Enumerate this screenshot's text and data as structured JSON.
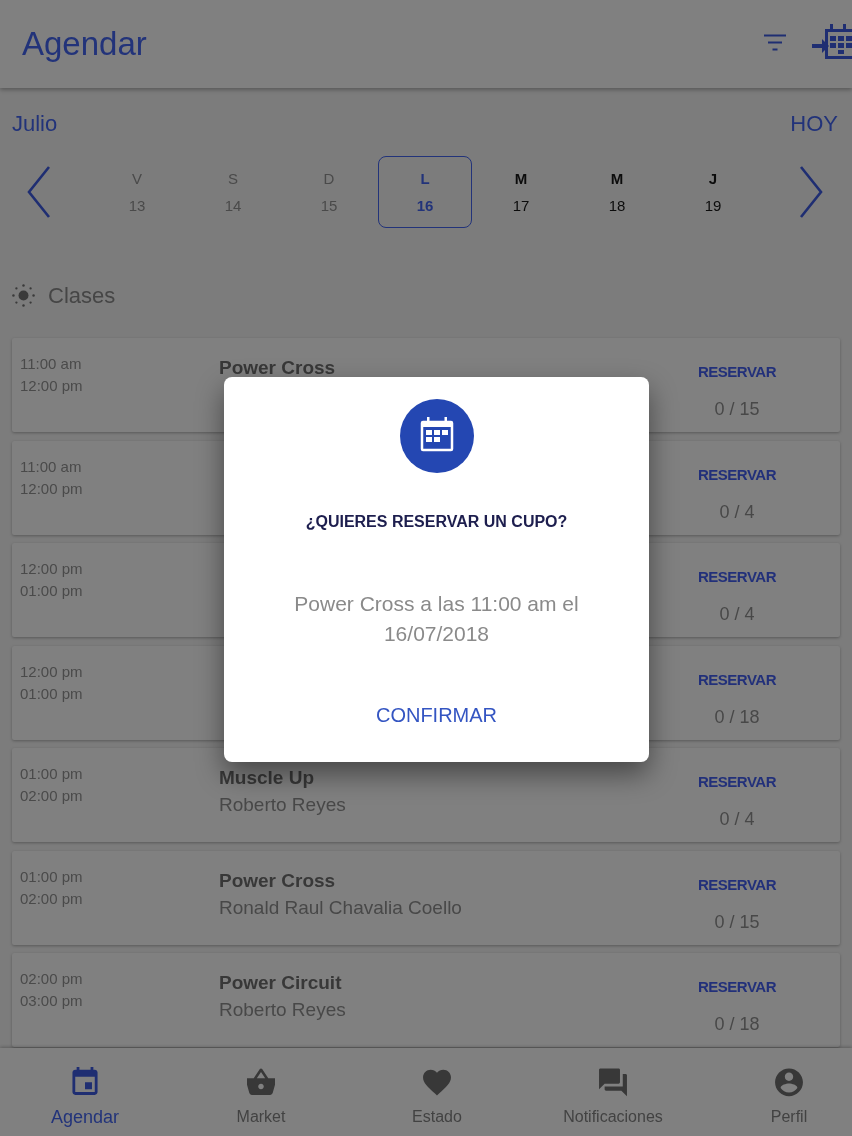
{
  "header": {
    "title": "Agendar"
  },
  "calendar": {
    "month": "Julio",
    "today_button": "HOY",
    "days": [
      {
        "weekday": "V",
        "date": "13",
        "disabled": true,
        "selected": false
      },
      {
        "weekday": "S",
        "date": "14",
        "disabled": true,
        "selected": false
      },
      {
        "weekday": "D",
        "date": "15",
        "disabled": true,
        "selected": false
      },
      {
        "weekday": "L",
        "date": "16",
        "disabled": false,
        "selected": true
      },
      {
        "weekday": "M",
        "date": "17",
        "disabled": false,
        "selected": false
      },
      {
        "weekday": "M",
        "date": "18",
        "disabled": false,
        "selected": false
      },
      {
        "weekday": "J",
        "date": "19",
        "disabled": false,
        "selected": false
      }
    ]
  },
  "section": {
    "title": "Clases"
  },
  "classes": [
    {
      "start": "11:00 am",
      "end": "12:00 pm",
      "name": "Power Cross",
      "action": "RESERVAR",
      "capacity": "0 / 15"
    },
    {
      "start": "11:00 am",
      "end": "12:00 pm",
      "action": "RESERVAR",
      "capacity": "0 / 4"
    },
    {
      "start": "12:00 pm",
      "end": "01:00 pm",
      "action": "RESERVAR",
      "capacity": "0 / 4"
    },
    {
      "start": "12:00 pm",
      "end": "01:00 pm",
      "action": "RESERVAR",
      "capacity": "0 / 18"
    },
    {
      "start": "01:00 pm",
      "end": "02:00 pm",
      "name": "Muscle Up",
      "instructor": "Roberto Reyes",
      "action": "RESERVAR",
      "capacity": "0 / 4"
    },
    {
      "start": "01:00 pm",
      "end": "02:00 pm",
      "name": "Power Cross",
      "instructor": "Ronald Raul Chavalia Coello",
      "action": "RESERVAR",
      "capacity": "0 / 15"
    },
    {
      "start": "02:00 pm",
      "end": "03:00 pm",
      "name": "Power Circuit",
      "instructor": "Roberto Reyes",
      "action": "RESERVAR",
      "capacity": "0 / 18"
    }
  ],
  "dialog": {
    "title": "¿QUIERES RESERVAR UN CUPO?",
    "message": "Power Cross a las 11:00 am el 16/07/2018",
    "confirm": "CONFIRMAR"
  },
  "bottom_nav": [
    {
      "label": "Agendar",
      "kind": "calendar",
      "selected": true
    },
    {
      "label": "Market",
      "kind": "basket",
      "selected": false
    },
    {
      "label": "Estado",
      "kind": "heart",
      "selected": false
    },
    {
      "label": "Notificaciones",
      "kind": "chat",
      "selected": false
    },
    {
      "label": "Perfil",
      "kind": "profile",
      "selected": false
    }
  ]
}
